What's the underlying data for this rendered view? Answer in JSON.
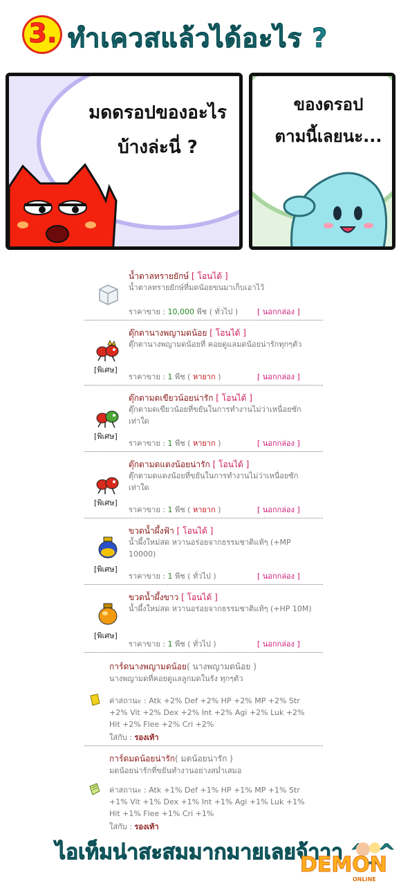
{
  "header": {
    "number": "3.",
    "title": "ทำเควสแล้วได้อะไร ?"
  },
  "panels": {
    "left_speech_line1": "มดดรอปของอะไร",
    "left_speech_line2": "บ้างล่ะนี่ ?",
    "right_speech_line1": "ของดรอป",
    "right_speech_line2": "ตามนี้เลยนะ..."
  },
  "labels": {
    "price_prefix": "ราคาขาย :",
    "currency": "พีช",
    "special": "[พิเศษ]",
    "box": "[ นอกกล่อง ]",
    "status_prefix": "ค่าสถานะ :",
    "equip_prefix": "ใส่กับ :"
  },
  "items": [
    {
      "name": "น้ำตาลทรายยักษ์",
      "tag": "[ โอนได้ ]",
      "desc": "น้ำตาลทรายยักษ์ที่มดน้อยขนมาเก็บเอาไว้",
      "price": "10,000",
      "rarity": "( ทั่วไป )",
      "special": false,
      "icon": "sugar-cube-icon"
    },
    {
      "name": "ตุ๊กตานางพญามดน้อย",
      "tag": "[ โอนได้ ]",
      "desc": "ตุ๊กตานางพญามดน้อยที่ คอยดูแลมดน้อยน่ารักทุกๆตัว",
      "price": "1",
      "rarity": "หายาก",
      "special": true,
      "icon": "ant-queen-doll-icon"
    },
    {
      "name": "ตุ๊กตามดเขียวน้อยน่ารัก",
      "tag": "[ โอนได้ ]",
      "desc": "ตุ๊กตามดเขียวน้อยที่ขยันในการทำงานไม่ว่าเหนื่อยซักเท่าใด",
      "price": "1",
      "rarity": "หายาก",
      "special": true,
      "icon": "green-ant-doll-icon"
    },
    {
      "name": "ตุ๊กตามดแดงน้อยน่ารัก",
      "tag": "[ โอนได้ ]",
      "desc": "ตุ๊กตามดแดงน้อยที่ขยันในการทำงานไม่ว่าเหนื่อยซักเท่าใด",
      "price": "1",
      "rarity": "หายาก",
      "special": true,
      "icon": "red-ant-doll-icon"
    },
    {
      "name": "ขวดน้ำผึ้งฟ้า",
      "tag": "[ โอนได้ ]",
      "desc": "น้ำผึ้งใหม่สด หวานอร่อยจากธรรมชาติแท้ๆ (+MP 10000)",
      "price": "1",
      "rarity": "( ทั่วไป )",
      "special": true,
      "icon": "blue-honey-bottle-icon"
    },
    {
      "name": "ขวดน้ำผึ้งขาว",
      "tag": "[ โอนได้ ]",
      "desc": "น้ำผึ้งใหม่สด หวานอร่อยจากธรรมชาติแท้ๆ (+HP 10M)",
      "price": "1",
      "rarity": "( ทั่วไป )",
      "special": true,
      "icon": "white-honey-bottle-icon"
    }
  ],
  "cards": [
    {
      "title": "การ์ดนางพญามดน้อย",
      "subtitle": "( นางพญามดน้อย )",
      "desc": "นางพญามดที่คอยดูแลลูกมดในรัง ทุกๆตัว",
      "stats": "Atk +2% Def +2% HP +2% MP +2% Str +2% Vit +2% Dex +2% Int +2% Agi +2% Luk +2% Hit +2% Flee +2% Cri +2%",
      "equip": "รองเท้า",
      "icon": "yellow-card-icon",
      "color": "#f2d21c"
    },
    {
      "title": "การ์ดมดน้อยน่ารัก",
      "subtitle": "( มดน้อยน่ารัก )",
      "desc": "มดน้อยน่ารักที่ขยันทำงานอย่างสม่ำเสมอ",
      "stats": "Atk +1% Def +1% HP +1% MP +1% Str +1% Vit +1% Dex +1% Int +1% Agi +1% Luk +1% Hit +1% Flee +1% Cri +1%",
      "equip": "รองเท้า",
      "icon": "green-card-icon",
      "color": "#cfe88a"
    }
  ],
  "footer": {
    "text": "ไอเท็มน่าสะสมมากมายเลยจ้าาา ^_^"
  },
  "logo": {
    "text": "DEMON",
    "sub": "ONLINE"
  },
  "colors": {
    "title": "#1d7f86",
    "accent_red": "#ff2d1a",
    "badge_yellow": "#ffe600",
    "name": "#8b1a1a",
    "tag": "#cc1a55",
    "price_green": "#22861f",
    "price_red": "#c0121b"
  }
}
